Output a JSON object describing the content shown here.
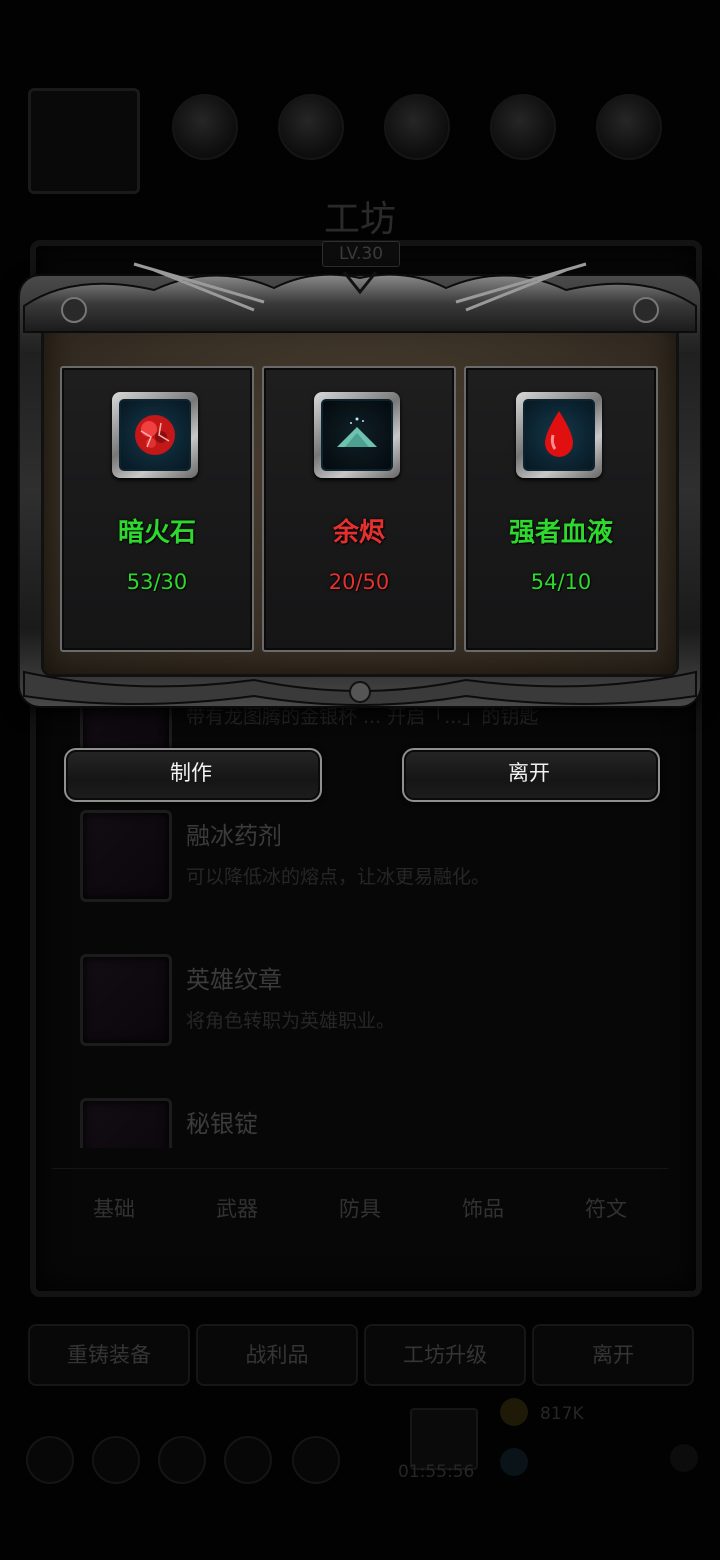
{
  "background": {
    "title": "工坊",
    "level": "LV.30",
    "items": [
      {
        "name": "",
        "desc": "带有龙图腾的金银杯 ... 开启「...」的钥匙"
      },
      {
        "name": "融冰药剂",
        "desc": "可以降低冰的熔点，让冰更易融化。"
      },
      {
        "name": "英雄纹章",
        "desc": "将角色转职为英雄职业。"
      },
      {
        "name": "秘银锭",
        "desc": ""
      }
    ],
    "tabs": [
      "基础",
      "武器",
      "防具",
      "饰品",
      "符文"
    ],
    "buttons": [
      "重铸装备",
      "战利品",
      "工坊升级",
      "离开"
    ],
    "gift_value": "01:55:56",
    "coin_value": "817K"
  },
  "dialog": {
    "materials": [
      {
        "name": "暗火石",
        "count": "53/30",
        "status": "enough",
        "icon": "red-crystal-icon"
      },
      {
        "name": "余烬",
        "count": "20/50",
        "status": "insufficient",
        "icon": "ember-pile-icon"
      },
      {
        "name": "强者血液",
        "count": "54/10",
        "status": "enough",
        "icon": "blood-drop-icon"
      }
    ],
    "craft_label": "制作",
    "leave_label": "离开"
  },
  "colors": {
    "enough": "#2ed82e",
    "insufficient": "#e53030",
    "parchment": "#3a3126",
    "frame": "#2f2f2f"
  }
}
